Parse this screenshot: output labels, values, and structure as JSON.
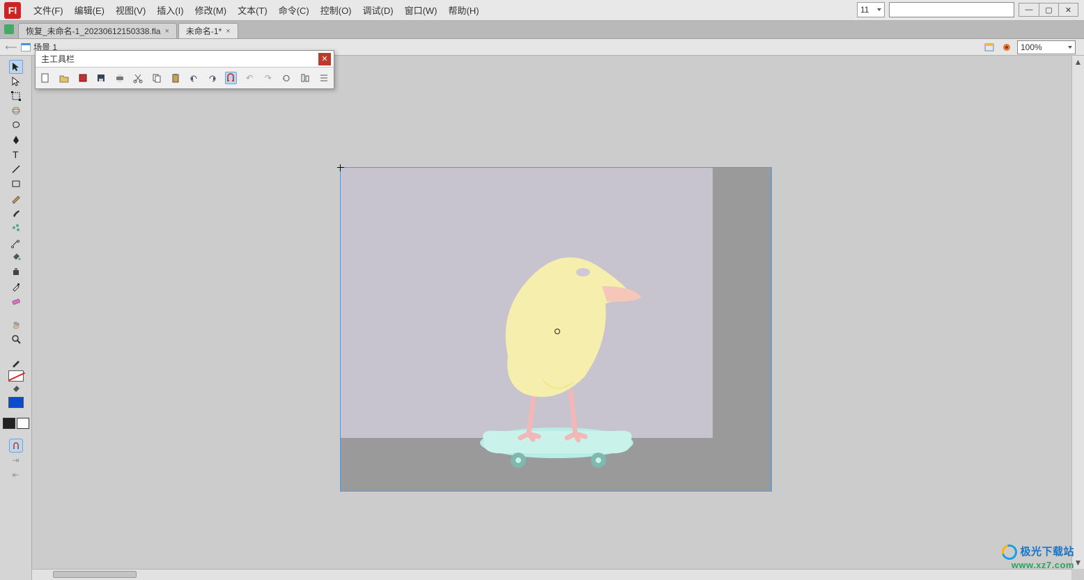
{
  "app": {
    "logo_text": "Fl"
  },
  "menu": {
    "file": "文件(F)",
    "edit": "编辑(E)",
    "view": "视图(V)",
    "insert": "插入(I)",
    "modify": "修改(M)",
    "text": "文本(T)",
    "cmd": "命令(C)",
    "control": "控制(O)",
    "debug": "调试(D)",
    "window": "窗口(W)",
    "help": "帮助(H)"
  },
  "mode_selector": "11",
  "search_placeholder": "",
  "tabs": [
    {
      "label": "恢复_未命名-1_20230612150338.fla",
      "active": false
    },
    {
      "label": "未命名-1*",
      "active": true
    }
  ],
  "scene": {
    "label": "场景 1"
  },
  "zoom": "100%",
  "floating_toolbar": {
    "title": "主工具栏"
  },
  "toolbar_icon_names": {
    "new": "new-file-icon",
    "open": "open-folder-icon",
    "import": "import-icon",
    "save": "save-icon",
    "print": "print-icon",
    "cut": "cut-icon",
    "copy": "copy-icon",
    "paste": "paste-icon",
    "undo": "undo-icon",
    "redo": "redo-icon",
    "snap": "snap-magnet-icon",
    "rotL": "rotate-left-icon",
    "rotR": "rotate-right-icon",
    "refresh": "refresh-icon",
    "align": "align-icon",
    "distribute": "distribute-icon"
  },
  "tool_names": {
    "selection": "selection-tool",
    "subselect": "subselection-tool",
    "freexform": "free-transform-tool",
    "3drot": "3d-rotation-tool",
    "lasso": "lasso-tool",
    "pen": "pen-tool",
    "text": "text-tool",
    "line": "line-tool",
    "rect": "rectangle-tool",
    "pencil": "pencil-tool",
    "brush": "brush-tool",
    "deco": "deco-tool",
    "bone": "bone-tool",
    "paint": "paint-bucket-tool",
    "ink": "ink-bottle-tool",
    "eye": "eyedropper-tool",
    "eraser": "eraser-tool",
    "hand": "hand-tool",
    "zoom": "zoom-tool"
  },
  "colors": {
    "stroke": "#ff0000",
    "fill": "#0a4bd0"
  },
  "watermark": {
    "line1": "极光下载站",
    "line2": "www.xz7.com"
  }
}
